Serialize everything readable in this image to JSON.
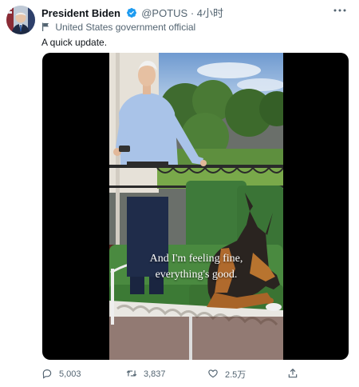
{
  "author": {
    "name": "President Biden",
    "handle": "@POTUS",
    "separator": "·",
    "time": "4小时",
    "label": "United States government official"
  },
  "tweet": {
    "text": "A quick update.",
    "video_caption_line1": "And I'm feeling fine,",
    "video_caption_line2": "everything's good."
  },
  "metrics": {
    "replies": "5,003",
    "retweets": "3,837",
    "likes": "2.5万"
  },
  "icons": [
    "verified-badge-icon",
    "more-icon",
    "government-flag-icon",
    "reply-icon",
    "retweet-icon",
    "like-icon",
    "share-icon"
  ],
  "colors": {
    "verified": "#1d9bf0",
    "secondary_text": "#536471",
    "primary_text": "#0f1419",
    "media_background": "#000000"
  }
}
